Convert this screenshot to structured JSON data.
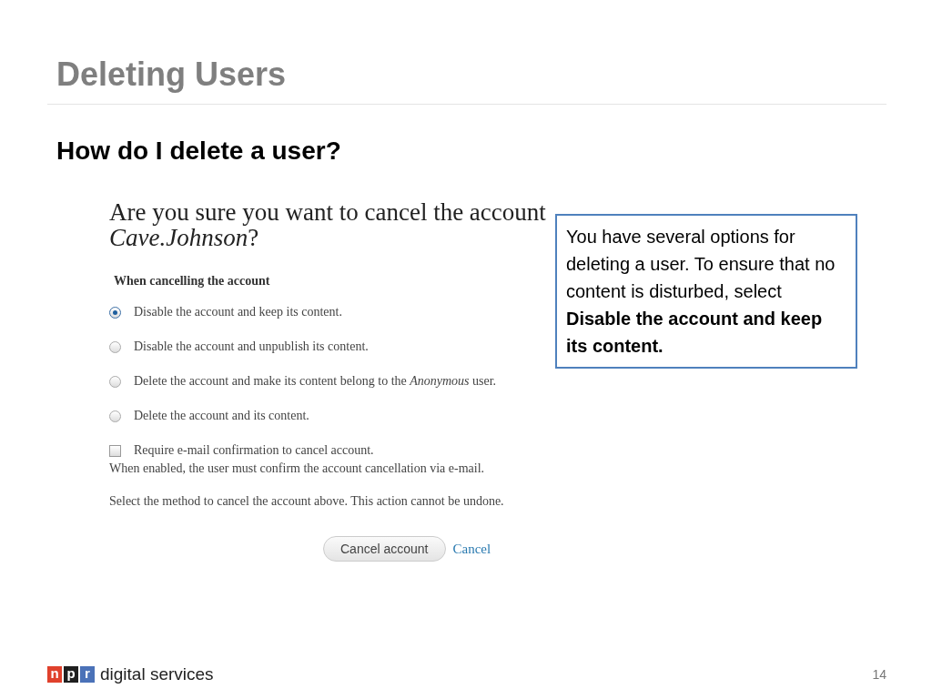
{
  "slide": {
    "title": "Deleting Users",
    "subtitle": "How do I delete a user?"
  },
  "form": {
    "heading": "Are you sure you want to cancel the account *Cave.Johnson*?",
    "group_label": "When cancelling the account",
    "options": [
      {
        "label": "Disable the account and keep its content.",
        "selected": true
      },
      {
        "label": "Disable the account and unpublish its content.",
        "selected": false
      },
      {
        "label": "Delete the account and make its content belong to the *Anonymous* user.",
        "selected": false
      },
      {
        "label": "Delete the account and its content.",
        "selected": false
      }
    ],
    "checkbox": {
      "label": "Require e-mail confirmation to cancel account.",
      "checked": false,
      "description": "When enabled, the user must confirm the account cancellation via e-mail."
    },
    "note": "Select the method to cancel the account above. This action cannot be undone.",
    "submit": "Cancel account",
    "cancel_link": "Cancel"
  },
  "callout": "You have several options for deleting a user. To ensure that no content is disturbed, select **Disable the account and keep its content.**",
  "footer": {
    "logo_letters": [
      {
        "text": "n",
        "color": "#e0412c"
      },
      {
        "text": "p",
        "color": "#1f1f1f"
      },
      {
        "text": "r",
        "color": "#4b72b8"
      }
    ],
    "logo_text": "digital services",
    "page_number": "14"
  }
}
